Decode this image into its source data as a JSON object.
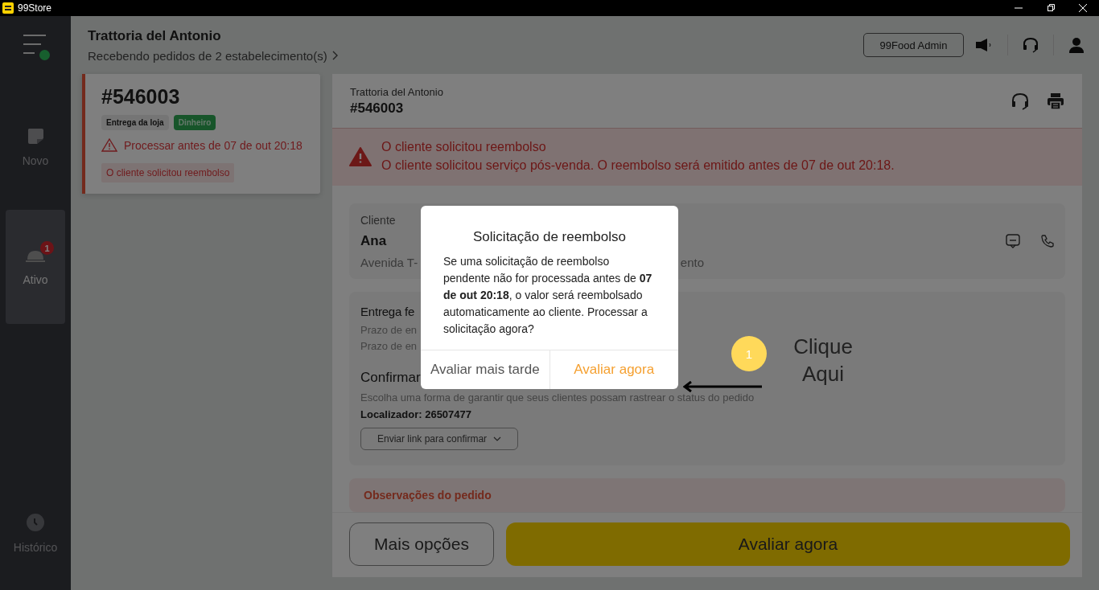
{
  "app": {
    "name": "99Store"
  },
  "sidebar": {
    "online": true,
    "items": [
      {
        "label": "Novo",
        "kind": "new",
        "selected": false
      },
      {
        "label": "Ativo",
        "kind": "active",
        "selected": true,
        "badge": "1"
      },
      {
        "label": "Histórico",
        "kind": "history",
        "selected": false
      }
    ]
  },
  "header": {
    "title": "Trattoria del Antonio",
    "subtitle": "Recebendo pedidos de 2 estabelecimento(s)",
    "admin_button": "99Food Admin"
  },
  "order_list": [
    {
      "number": "#546003",
      "selected": true,
      "tags": [
        {
          "label": "Entrega da loja",
          "kind": "neutral"
        },
        {
          "label": "Dinheiro",
          "kind": "payment"
        }
      ],
      "deadline": "Processar antes de 07 de out 20:18",
      "status": "O cliente solicitou reembolso"
    }
  ],
  "order_detail": {
    "store": "Trattoria del Antonio",
    "number": "#546003",
    "alert": {
      "title": "O cliente solicitou reembolso",
      "message": "O cliente solicitou serviço pós-venda. O reembolso será emitido antes de 07 de out 20:18."
    },
    "customer": {
      "label": "Cliente",
      "name": "Ana",
      "address_parts": [
        "Avenida T-",
        "ento"
      ]
    },
    "delivery": {
      "title": "Entrega fe",
      "lines": [
        "Prazo de en",
        "Prazo de en"
      ]
    },
    "confirmation": {
      "title": "Confirmar",
      "description": "Escolha uma forma de garantir que seus clientes possam rastrear o status do pedido",
      "locator": "Localizador: 26507477",
      "button": "Enviar link para confirmar"
    },
    "notes": {
      "title": "Observações do pedido"
    },
    "actions": [
      "Mais opções",
      "Avaliar agora"
    ]
  },
  "dialog": {
    "title": "Solicitação de reembolso",
    "body": "Se uma solicitação de reembolso pendente não for processada antes de **07 de out 20:18**, o valor será reembolsado automaticamente ao cliente. Processar a solicitação agora?",
    "buttons": [
      {
        "label": "Avaliar mais tarde",
        "kind": "secondary"
      },
      {
        "label": "Avaliar agora",
        "kind": "primary"
      }
    ]
  },
  "callout": {
    "step": "1",
    "text": "Clique Aqui"
  }
}
